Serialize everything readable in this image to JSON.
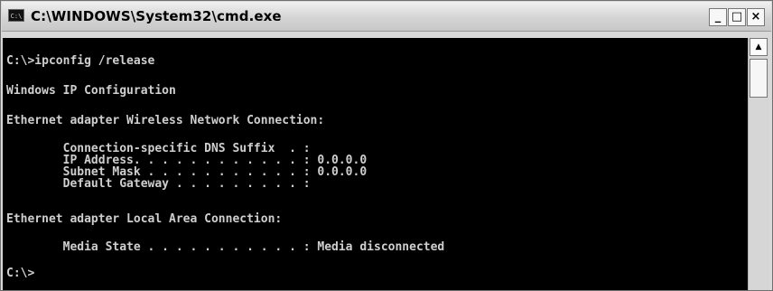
{
  "window": {
    "title": "C:\\WINDOWS\\System32\\cmd.exe",
    "icon_text": "C:\\",
    "controls": {
      "minimize": "_",
      "maximize": "□",
      "close": "×"
    }
  },
  "console": {
    "lines": [
      "C:\\>ipconfig /release",
      "Windows IP Configuration",
      "Ethernet adapter Wireless Network Connection:",
      "        Connection-specific DNS Suffix  . :",
      "        IP Address. . . . . . . . . . . . : 0.0.0.0",
      "        Subnet Mask . . . . . . . . . . . : 0.0.0.0",
      "        Default Gateway . . . . . . . . . :",
      "Ethernet adapter Local Area Connection:",
      "        Media State . . . . . . . . . . . : Media disconnected",
      "C:\\>"
    ]
  },
  "scrollbar": {
    "up_arrow": "▲"
  }
}
